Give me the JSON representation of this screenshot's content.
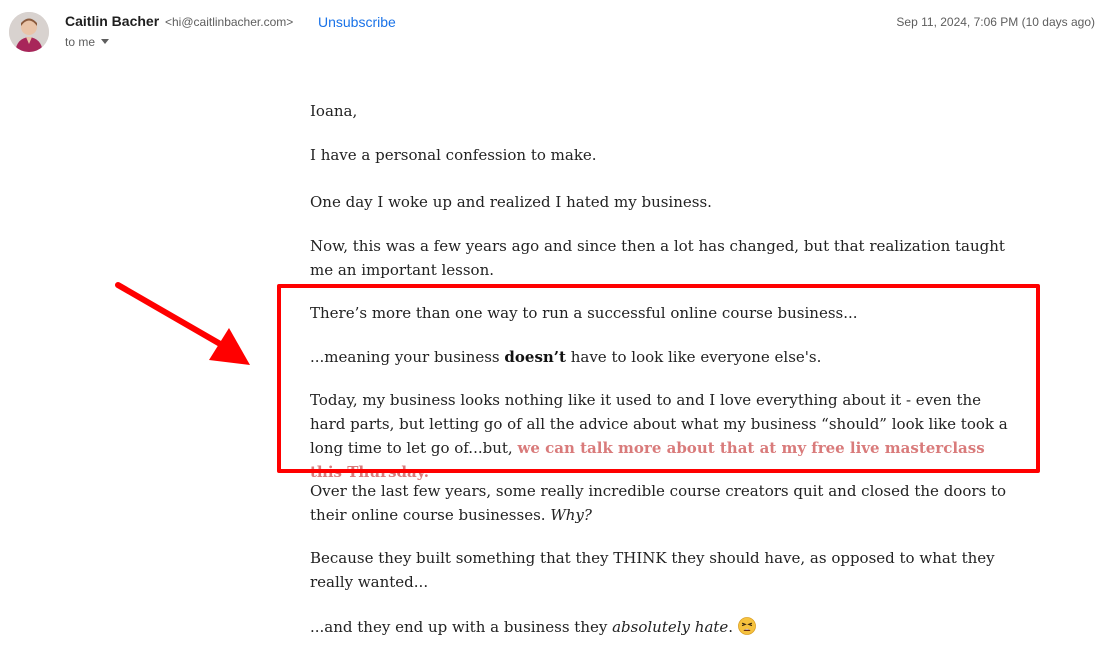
{
  "header": {
    "sender_name": "Caitlin Bacher",
    "sender_email": "<hi@caitlinbacher.com>",
    "unsubscribe_label": "Unsubscribe",
    "recipient_label": "to me",
    "timestamp": "Sep 11, 2024, 7:06 PM (10 days ago)"
  },
  "email": {
    "greeting": "Ioana,",
    "p1": "I have a personal confession to make.",
    "p2": "One day I woke up and realized I hated my business.",
    "p3": "Now, this was a few years ago and since then a lot has changed, but that realization taught me an important lesson.",
    "p4": "There’s more than one way to run a successful online course business...",
    "p5_pre": "...meaning your business ",
    "p5_bold": "doesn’t",
    "p5_post": " have to look like everyone else's.",
    "p6_text": "Today, my business looks nothing like it used to and I love everything about it - even the hard parts, but letting go of all the advice about what my business “should” look like took a long time to let go of...but, ",
    "p6_link": "we can talk more about that at my free live masterclass this Thursday.",
    "p7_text": "Over the last few years, some really incredible course creators quit and closed the doors to their online course businesses. ",
    "p7_italic": "Why?",
    "p8": "Because they built something that they THINK they should have, as opposed to what they really wanted...",
    "p9_pre": "...and they end up with a business they ",
    "p9_italic": "absolutely hate",
    "p9_post": "."
  },
  "colors": {
    "link": "#1a73e8",
    "annotation": "#ff0000",
    "masterclass_link": "#d97b7b"
  },
  "icons": {
    "avatar": "sender-avatar",
    "emoji": "tired-face-emoji"
  }
}
